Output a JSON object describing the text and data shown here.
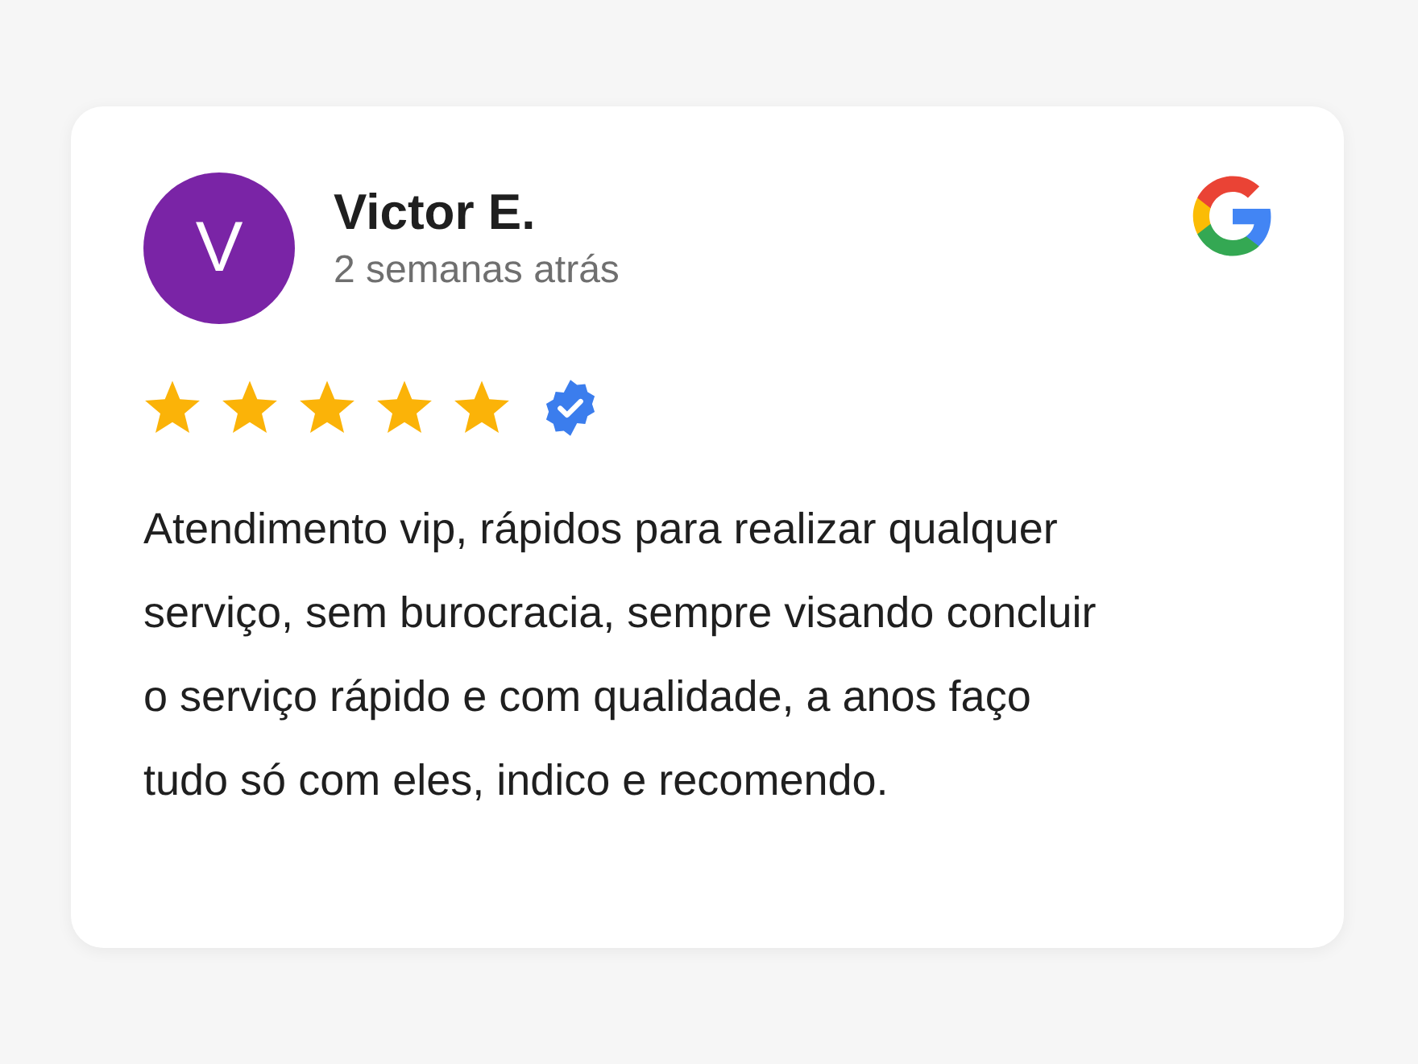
{
  "review": {
    "avatar_letter": "V",
    "author": "Victor E.",
    "time": "2 semanas atrás",
    "stars": 5,
    "verified": true,
    "text": "Atendimento vip, rápidos para realizar qualquer serviço, sem burocracia, sempre visando concluir o serviço rápido e com qualidade, a anos faço tudo só com eles, indico e recomendo."
  }
}
